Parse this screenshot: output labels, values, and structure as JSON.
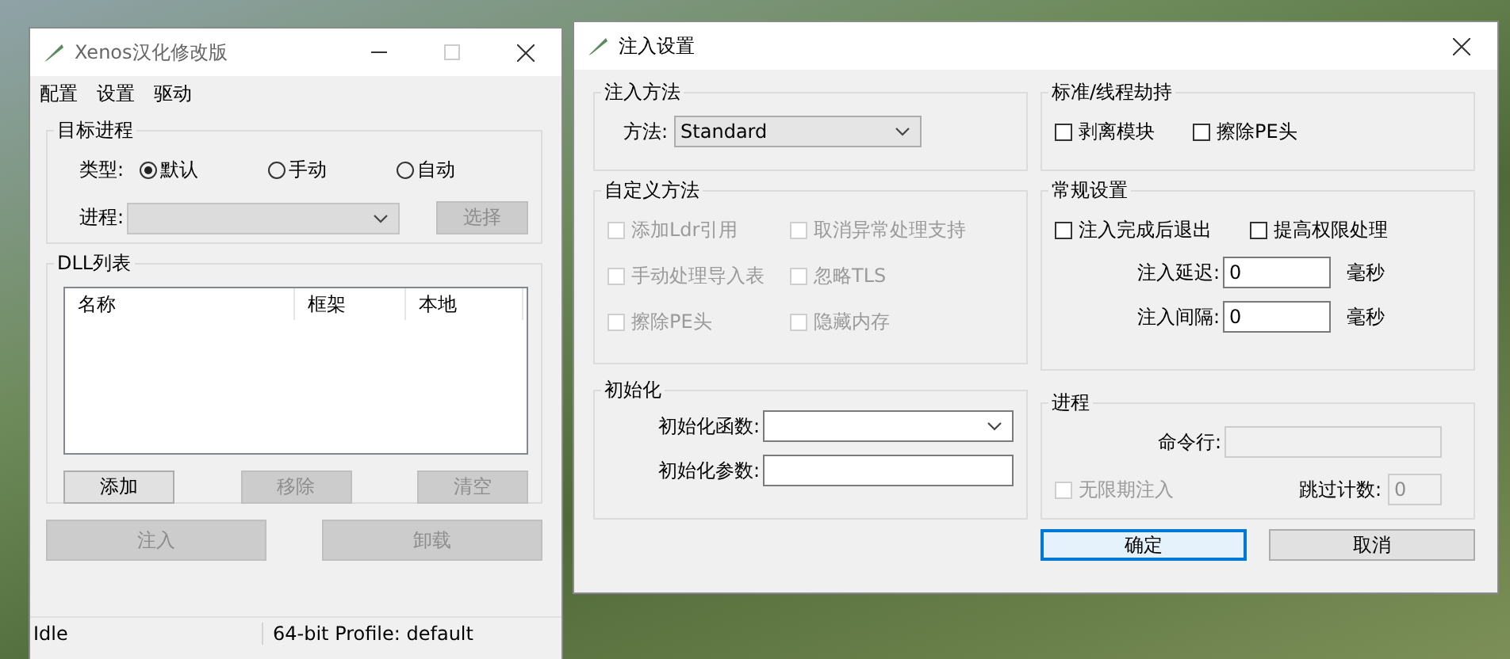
{
  "main_window": {
    "title": "Xenos汉化修改版",
    "menu": [
      "配置",
      "设置",
      "驱动"
    ],
    "target_process": {
      "title": "目标进程",
      "type_label": "类型:",
      "types": [
        {
          "label": "默认",
          "selected": true
        },
        {
          "label": "手动",
          "selected": false
        },
        {
          "label": "自动",
          "selected": false
        }
      ],
      "process_label": "进程:",
      "process_disabled": true,
      "select_button": {
        "label": "选择",
        "disabled": true
      }
    },
    "dll_list": {
      "title": "DLL列表",
      "columns": [
        "名称",
        "框架",
        "本地"
      ],
      "buttons": [
        {
          "label": "添加",
          "disabled": false
        },
        {
          "label": "移除",
          "disabled": true
        },
        {
          "label": "清空",
          "disabled": true
        }
      ]
    },
    "actions": [
      {
        "label": "注入",
        "disabled": true
      },
      {
        "label": "卸载",
        "disabled": true
      }
    ],
    "status_bar": [
      "Idle",
      "64-bit Profile: default"
    ]
  },
  "dialog": {
    "title": "注入设置",
    "method_group": {
      "title": "注入方法",
      "label": "方法:",
      "value": "Standard"
    },
    "custom_group": {
      "title": "自定义方法",
      "options": [
        {
          "label": "添加Ldr引用",
          "checked": false,
          "disabled": true
        },
        {
          "label": "取消异常处理支持",
          "checked": false,
          "disabled": true
        },
        {
          "label": "手动处理导入表",
          "checked": false,
          "disabled": true
        },
        {
          "label": "忽略TLS",
          "checked": false,
          "disabled": true
        },
        {
          "label": "擦除PE头",
          "checked": false,
          "disabled": true
        },
        {
          "label": "隐藏内存",
          "checked": false,
          "disabled": true
        }
      ]
    },
    "init_group": {
      "title": "初始化",
      "fields": [
        {
          "label": "初始化函数:",
          "kind": "dropdown"
        },
        {
          "label": "初始化参数:",
          "kind": "text"
        }
      ]
    },
    "thread_group": {
      "title": "标准/线程劫持",
      "options": [
        {
          "label": "剥离模块",
          "checked": false,
          "disabled": false
        },
        {
          "label": "擦除PE头",
          "checked": false,
          "disabled": false
        }
      ]
    },
    "general_group": {
      "title": "常规设置",
      "options": [
        {
          "label": "注入完成后退出",
          "checked": false,
          "disabled": false
        },
        {
          "label": "提高权限处理",
          "checked": false,
          "disabled": false
        }
      ],
      "fields": [
        {
          "label": "注入延迟:",
          "value": "0",
          "unit": "毫秒"
        },
        {
          "label": "注入间隔:",
          "value": "0",
          "unit": "毫秒"
        }
      ]
    },
    "process_group": {
      "title": "进程",
      "cmdline": {
        "label": "命令行:",
        "disabled": true
      },
      "option": {
        "label": "无限期注入",
        "checked": false,
        "disabled": true
      },
      "skip": {
        "label": "跳过计数:",
        "value": "0",
        "disabled": true
      }
    },
    "buttons": [
      {
        "label": "确定",
        "default": true
      },
      {
        "label": "取消",
        "default": false
      }
    ]
  }
}
